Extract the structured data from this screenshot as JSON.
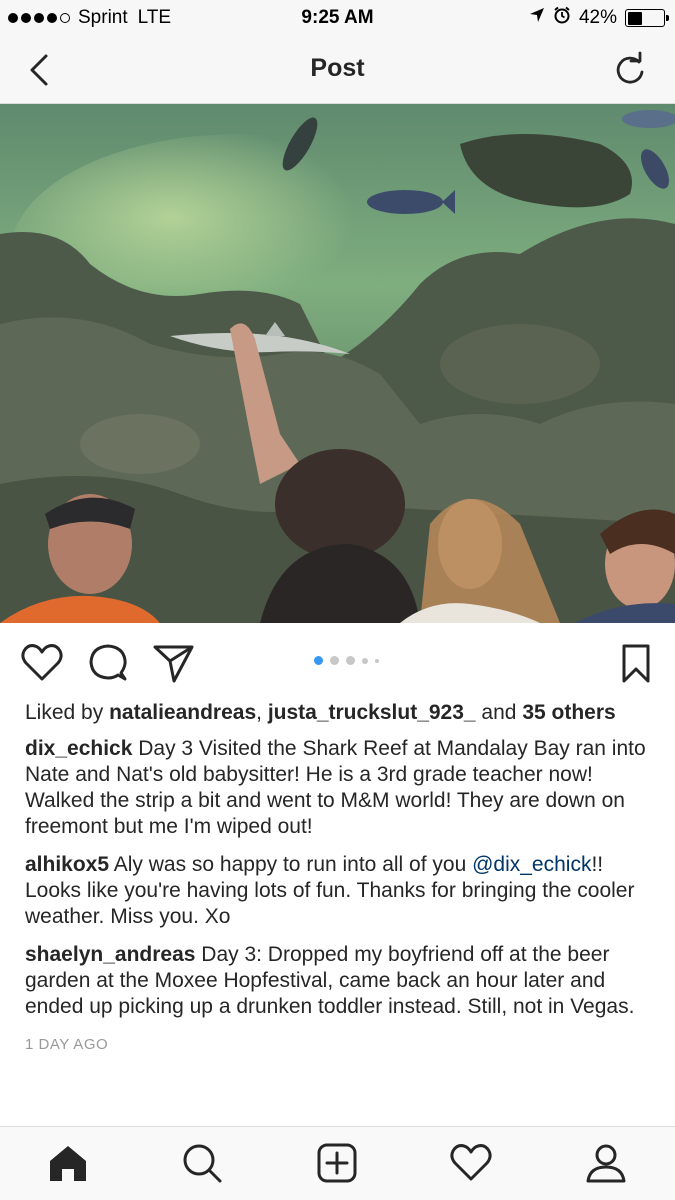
{
  "status_bar": {
    "carrier": "Sprint",
    "network": "LTE",
    "time": "9:25 AM",
    "battery_percent": "42%",
    "battery_level": 0.42,
    "icons": [
      "signal-dots-icon",
      "location-arrow-icon",
      "alarm-icon",
      "battery-icon"
    ]
  },
  "nav": {
    "title": "Post",
    "back_icon": "chevron-left-icon",
    "refresh_icon": "refresh-icon"
  },
  "photo": {
    "description_icon": "aquarium-photo"
  },
  "actions": {
    "icons": [
      "heart-icon",
      "comment-icon",
      "share-icon",
      "bookmark-icon"
    ],
    "carousel": {
      "total": 5,
      "active_index": 0
    }
  },
  "likes": {
    "prefix": "Liked by ",
    "user1": "natalieandreas",
    "separator": ", ",
    "user2": "justa_truckslut_923_",
    "and_text": " and ",
    "count": "35",
    "others": "others"
  },
  "comments": [
    {
      "username": "dix_echick",
      "text": " Day 3 Visited the Shark Reef at Mandalay Bay ran into Nate and Nat's old babysitter! He is a 3rd grade teacher now! Walked the strip a bit and went to M&M world! They are down on freemont but me I'm wiped out!"
    },
    {
      "username": "alhikox5",
      "text_before": " Aly was so happy to run into all of you ",
      "mention": "@dix_echick",
      "text_after": "!! Looks like you're having lots of fun. Thanks for bringing the cooler weather. Miss you. Xo"
    },
    {
      "username": "shaelyn_andreas",
      "text": " Day 3: Dropped my boyfriend off at the beer garden at the Moxee Hopfestival, came back an hour later and ended up picking up a drunken toddler instead. Still, not in Vegas."
    }
  ],
  "timestamp": "1 DAY AGO",
  "tab_bar": {
    "items": [
      "home-icon",
      "search-icon",
      "add-post-icon",
      "activity-heart-icon",
      "profile-icon"
    ]
  },
  "colors": {
    "text": "#262626",
    "link": "#003569",
    "muted": "#999999",
    "active_dot": "#3897f0",
    "bar_bg": "#f7f7f7"
  }
}
